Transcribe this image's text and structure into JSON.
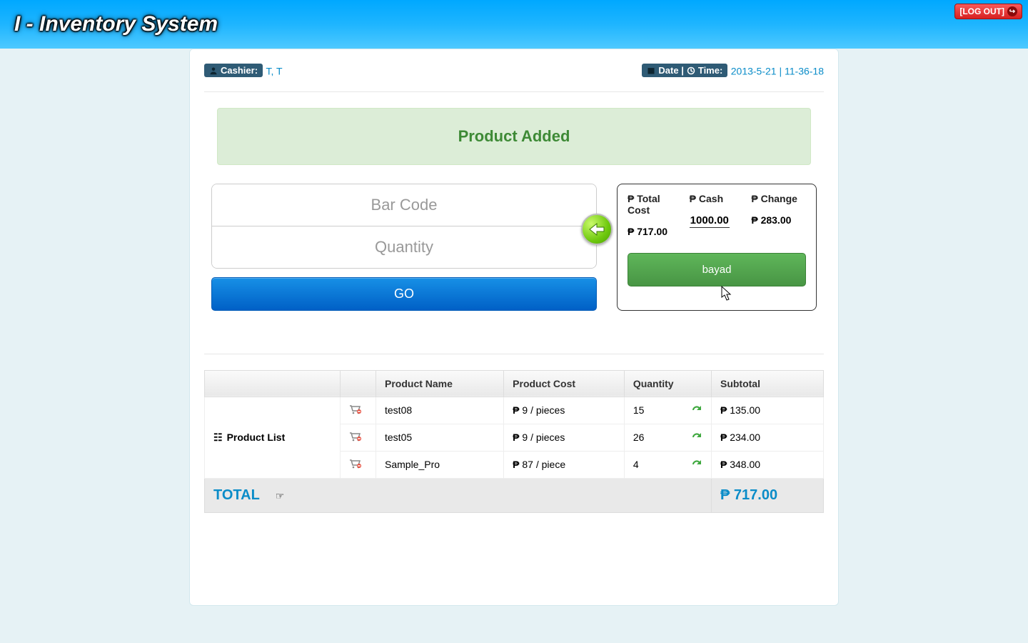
{
  "header": {
    "app_title": "I - Inventory System",
    "logout_label": "[LOG OUT]"
  },
  "info": {
    "cashier_label": "Cashier:",
    "cashier_value": "T, T",
    "date_label": "Date |",
    "time_label": "Time:",
    "datetime_value": "2013-5-21 | 11-36-18"
  },
  "alert": "Product Added",
  "inputs": {
    "barcode_placeholder": "Bar Code",
    "quantity_placeholder": "Quantity",
    "go_label": "GO"
  },
  "payment": {
    "total_cost_hdr": "Total Cost",
    "cash_hdr": "Cash",
    "change_hdr": "Change",
    "total_cost_val": "717.00",
    "cash_val": "1000.00",
    "change_val": "283.00",
    "pay_label": "bayad"
  },
  "table": {
    "headers": [
      "",
      "",
      "Product Name",
      "Product Cost",
      "Quantity",
      "Subtotal"
    ],
    "first_cell": "Product List",
    "rows": [
      {
        "name": "test08",
        "cost": "9 / pieces",
        "qty": "15",
        "subtotal": "135.00"
      },
      {
        "name": "test05",
        "cost": "9 / pieces",
        "qty": "26",
        "subtotal": "234.00"
      },
      {
        "name": "Sample_Pro",
        "cost": "87 / piece",
        "qty": "4",
        "subtotal": "348.00"
      }
    ],
    "total_label": "TOTAL",
    "total_value": "717.00"
  },
  "peso": "₱"
}
